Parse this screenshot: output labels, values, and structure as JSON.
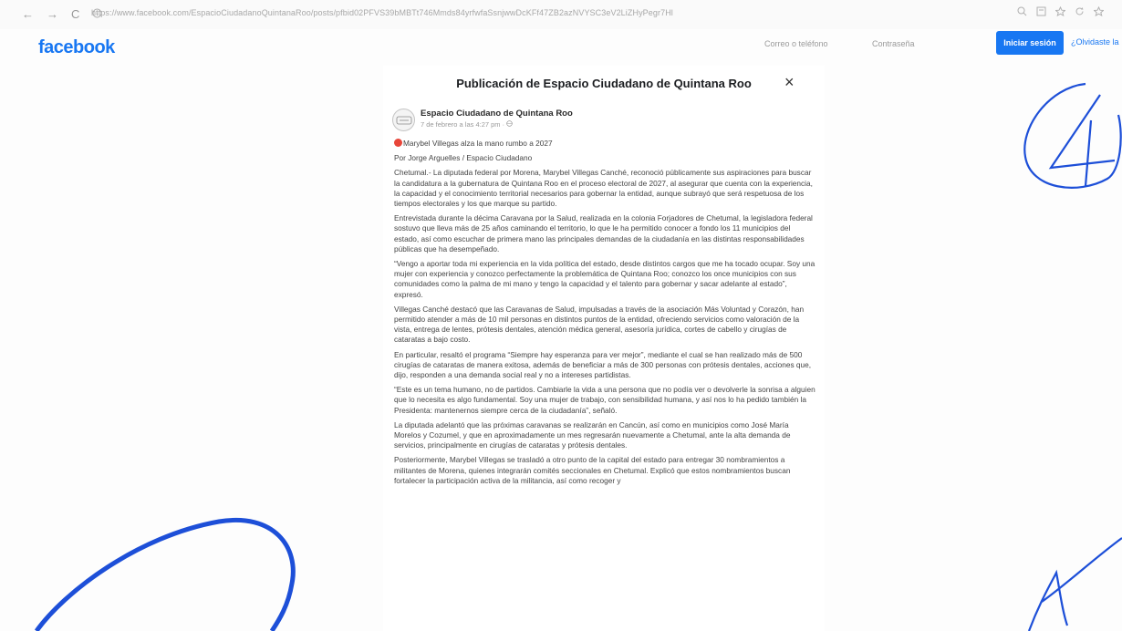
{
  "browser": {
    "nav_icons": [
      "back-icon",
      "forward-icon",
      "reload-icon",
      "site-info-icon"
    ],
    "back": "←",
    "forward": "→",
    "reload": "C",
    "url": "https://www.facebook.com/EspacioCiudadanoQuintanaRoo/posts/pfbid02PFVS39bMBTt746Mmds84yrfwfaSsnjwwDcKFf47ZB2azNVYSC3eV2LiZHyPegr7Hl"
  },
  "header": {
    "logo": "facebook",
    "email_placeholder": "Correo o teléfono",
    "password_placeholder": "Contraseña",
    "login_label": "Iniciar sesión",
    "forgot_label": "¿Olvidaste la"
  },
  "modal": {
    "title": "Publicación de Espacio Ciudadano de Quintana Roo",
    "close": "×"
  },
  "post": {
    "author": "Espacio Ciudadano de Quintana Roo",
    "date": "7 de febrero a las 4:27 pm · ",
    "headline": "Marybel Villegas alza la mano rumbo a 2027",
    "byline": "Por Jorge Arguelles / Espacio Ciudadano",
    "paragraphs": [
      "Chetumal.- La diputada federal por Morena, Marybel Villegas Canché, reconoció públicamente sus aspiraciones para buscar la candidatura a la gubernatura de Quintana Roo en el proceso electoral de 2027, al asegurar que cuenta con la experiencia, la capacidad y el conocimiento territorial necesarios para gobernar la entidad, aunque subrayó que será respetuosa de los tiempos electorales y los que marque su partido.",
      "Entrevistada durante la décima Caravana por la Salud, realizada en la colonia Forjadores de Chetumal, la legisladora federal sostuvo que lleva más de 25 años caminando el territorio, lo que le ha permitido conocer a fondo los 11 municipios del estado, así como escuchar de primera mano las principales demandas de la ciudadanía en las distintas responsabilidades públicas que ha desempeñado.",
      "“Vengo a aportar toda mi experiencia en la vida política del estado, desde distintos cargos que me ha tocado ocupar. Soy una mujer con experiencia y conozco perfectamente la problemática de Quintana Roo; conozco los once municipios con sus comunidades como la palma de mi mano y tengo la capacidad y el talento para gobernar y sacar adelante al estado”, expresó.",
      "Villegas Canché destacó que las Caravanas de Salud, impulsadas a través de la asociación Más Voluntad y Corazón, han permitido atender a más de 10 mil personas en distintos puntos de la entidad, ofreciendo servicios como valoración de la vista, entrega de lentes, prótesis dentales, atención médica general, asesoría jurídica, cortes de cabello y cirugías de cataratas a bajo costo.",
      "En particular, resaltó el programa “Siempre hay esperanza para ver mejor”, mediante el cual se han realizado más de 500 cirugías de cataratas de manera exitosa, además de beneficiar a más de 300 personas con prótesis dentales, acciones que, dijo, responden a una demanda social real y no a intereses partidistas.",
      "“Este es un tema humano, no de partidos. Cambiarle la vida a una persona que no podía ver o devolverle la sonrisa a alguien que lo necesita es algo fundamental. Soy una mujer de trabajo, con sensibilidad humana, y así nos lo ha pedido también la Presidenta: mantenernos siempre cerca de la ciudadanía”, señaló.",
      "La diputada adelantó que las próximas caravanas se realizarán en Cancún, así como en municipios como José María Morelos y Cozumel, y que en aproximadamente un mes regresarán nuevamente a Chetumal, ante la alta demanda de servicios, principalmente en cirugías de cataratas y prótesis dentales.",
      "Posteriormente, Marybel Villegas se trasladó a otro punto de la capital del estado para entregar 30 nombramientos a militantes de Morena, quienes integrarán comités seccionales en Chetumal. Explicó que estos nombramientos buscan fortalecer la participación activa de la militancia, así como recoger y"
    ]
  },
  "colors": {
    "brand": "#1877f2",
    "ink": "#1d4fd8",
    "headline_dot": "#e8463a"
  }
}
